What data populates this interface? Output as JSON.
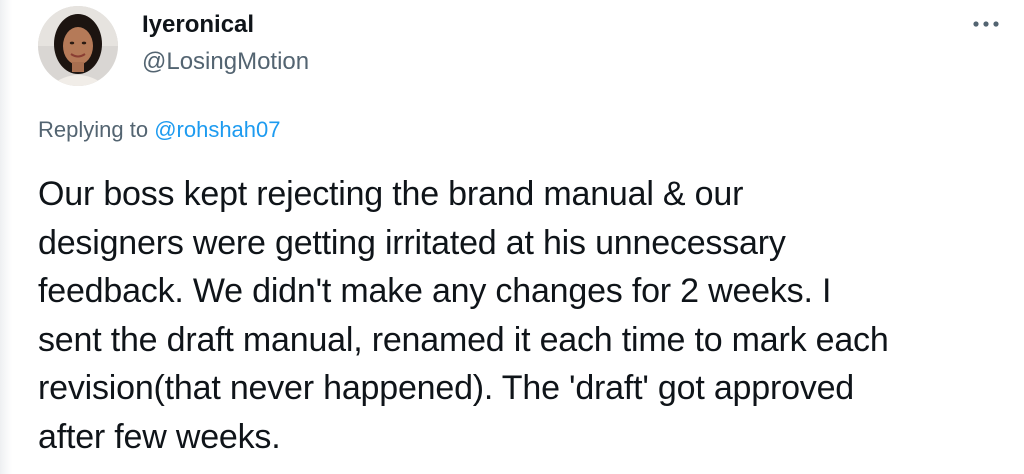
{
  "author": {
    "display_name": "Iyeronical",
    "handle": "@LosingMotion",
    "avatar_icon": "profile-photo-avatar"
  },
  "menu": {
    "icon": "more-options-icon"
  },
  "reply_context": {
    "prefix": "Replying to ",
    "mention": "@rohshah07"
  },
  "tweet": {
    "lines": [
      "Our boss kept rejecting the brand manual & our",
      "designers were getting irritated at his unnecessary",
      "feedback. We didn't make any changes for 2 weeks. I",
      "sent the draft manual, renamed it each time to mark each",
      "revision(that never happened). The 'draft' got approved",
      "after few weeks."
    ]
  },
  "colors": {
    "text_primary": "#0f1419",
    "text_secondary": "#536471",
    "link": "#1d9bf0"
  }
}
